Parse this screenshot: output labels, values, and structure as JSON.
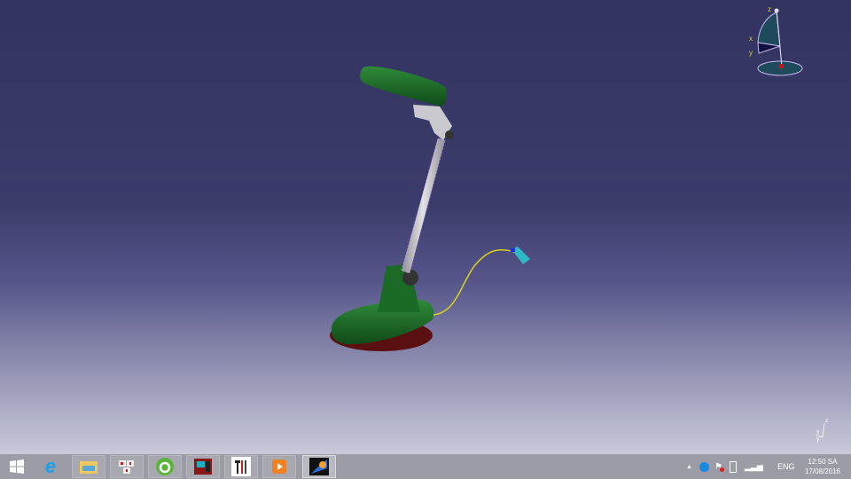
{
  "compass": {
    "axis_x": "x",
    "axis_y": "y",
    "axis_z": "z"
  },
  "mini_axis": {
    "axis_x": "x",
    "axis_y": "y",
    "axis_z": "z"
  },
  "taskbar": {
    "apps": [
      {
        "name": "start"
      },
      {
        "name": "internet-explorer"
      },
      {
        "name": "file-explorer"
      },
      {
        "name": "unikey"
      },
      {
        "name": "coc-coc-browser"
      },
      {
        "name": "system-tool"
      },
      {
        "name": "tools"
      },
      {
        "name": "media-player"
      },
      {
        "name": "catia"
      }
    ],
    "language": "ENG",
    "time": "12:50 SA",
    "date": "17/08/2016"
  }
}
